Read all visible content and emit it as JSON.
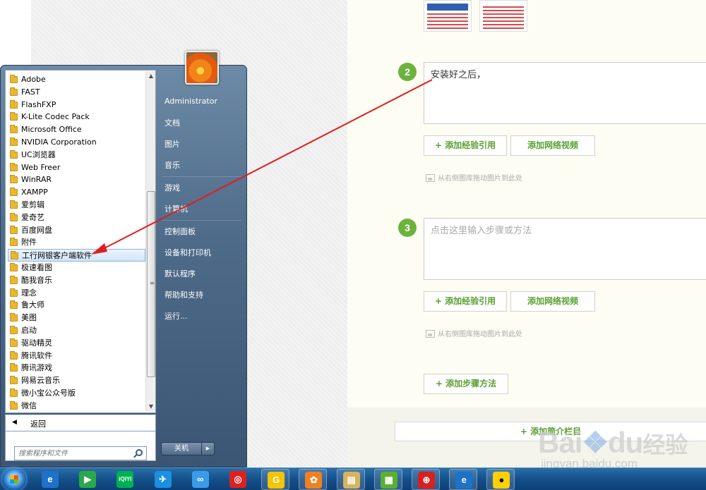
{
  "editor": {
    "step2": {
      "number": "2",
      "text": "安装好之后，"
    },
    "step3": {
      "number": "3",
      "placeholder": "点击这里输入步骤或方法"
    },
    "add_ref_label": "+ 添加经验引用",
    "add_video_label": "添加网络视频",
    "drag_hint": "从右侧图库拖动图片到此处",
    "add_step_label": "+ 添加步骤方法",
    "save_label": "+ 添加简介栏目"
  },
  "start_menu": {
    "programs": [
      "Adobe",
      "FAST",
      "FlashFXP",
      "K-Lite Codec Pack",
      "Microsoft Office",
      "NVIDIA Corporation",
      "UC浏览器",
      "Web Freer",
      "WinRAR",
      "XAMPP",
      "爱剪辑",
      "爱奇艺",
      "百度网盘",
      "附件",
      "工行网银客户端软件",
      "极速看图",
      "酷我音乐",
      "理念",
      "鲁大师",
      "美图",
      "启动",
      "驱动精灵",
      "腾讯软件",
      "腾讯游戏",
      "网易云音乐",
      "微小宝公众号版",
      "微信"
    ],
    "selected_program": "工行网银客户端软件",
    "back_label": "返回",
    "search_placeholder": "搜索程序和文件",
    "right_items": {
      "user": "Administrator",
      "documents": "文档",
      "pictures": "图片",
      "music": "音乐",
      "games": "游戏",
      "computer": "计算机",
      "control_panel": "控制面板",
      "devices": "设备和打印机",
      "default_programs": "默认程序",
      "help": "帮助和支持",
      "run": "运行..."
    },
    "shutdown_label": "关机"
  },
  "taskbar": {
    "apps": [
      "ie-icon",
      "media-player-icon",
      "iqiyi-icon",
      "feishu-icon",
      "baidu-netdisk-icon",
      "netease-music-icon",
      "game-icon",
      "uc-browser-icon",
      "file-explorer-icon",
      "picture-viewer-icon",
      "icbc-icon",
      "ie-icon",
      "qq-icon"
    ],
    "iqiyi_text": "iQIYI"
  },
  "watermark": {
    "logo_text": "Bai",
    "logo_text2": "du",
    "logo_cn": "经验",
    "url": "jingyan.baidu.com"
  },
  "colors": {
    "accent_green": "#6cb33e",
    "arrow_red": "#e01c1c",
    "taskbar_blue": "#14508a"
  }
}
